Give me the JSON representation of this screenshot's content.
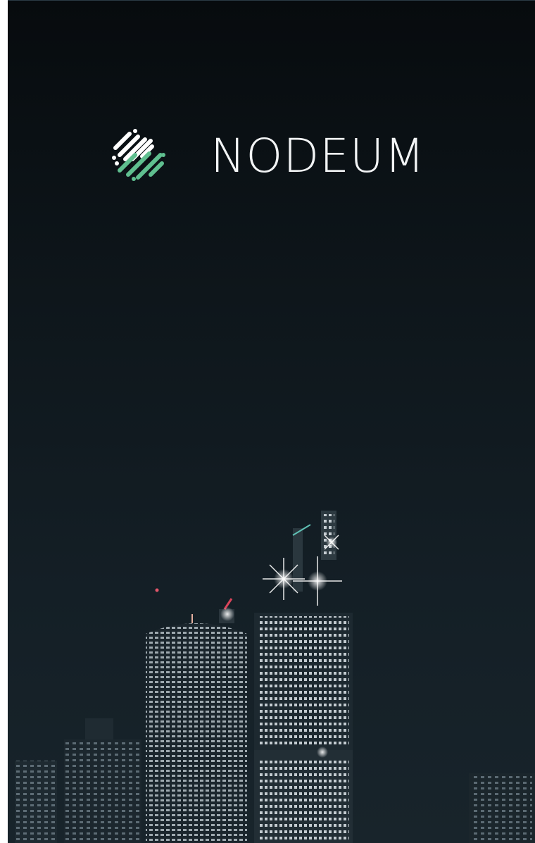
{
  "brand": {
    "name": "NODEUM",
    "mark_icon": "nodeum-logo-icon",
    "colors": {
      "wordmark": "#f2f4f5",
      "mark_white": "#ffffff",
      "mark_green": "#5fbf8f",
      "background_top": "#070b0e",
      "background_bottom": "#18242b"
    }
  },
  "background": {
    "image": "night-city-skyline"
  }
}
